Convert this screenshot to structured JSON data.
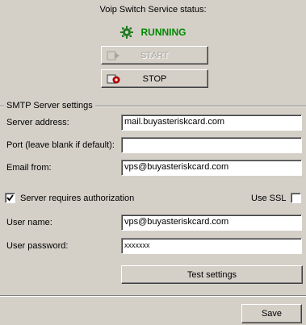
{
  "status": {
    "title": "Voip Switch Service status:",
    "state": "RUNNING",
    "start_label": "START",
    "stop_label": "STOP"
  },
  "smtp": {
    "group_title": "SMTP Server settings",
    "server_label": "Server address:",
    "server_value": "mail.buyasteriskcard.com",
    "port_label": "Port (leave blank if default):",
    "port_value": "",
    "email_label": "Email from:",
    "email_value": "vps@buyasteriskcard.com",
    "auth_label": "Server requires authorization",
    "auth_checked": true,
    "ssl_label": "Use SSL",
    "ssl_checked": false,
    "user_label": "User name:",
    "user_value": "vps@buyasteriskcard.com",
    "password_label": "User password:",
    "password_value": "xxxxxxx",
    "test_label": "Test settings"
  },
  "footer": {
    "save_label": "Save"
  },
  "colors": {
    "background": "#d4d0c8",
    "running": "#008800"
  },
  "icons": {
    "status": "gear-icon",
    "start": "start-icon",
    "stop": "stop-icon",
    "checkbox": "checkmark-icon"
  }
}
